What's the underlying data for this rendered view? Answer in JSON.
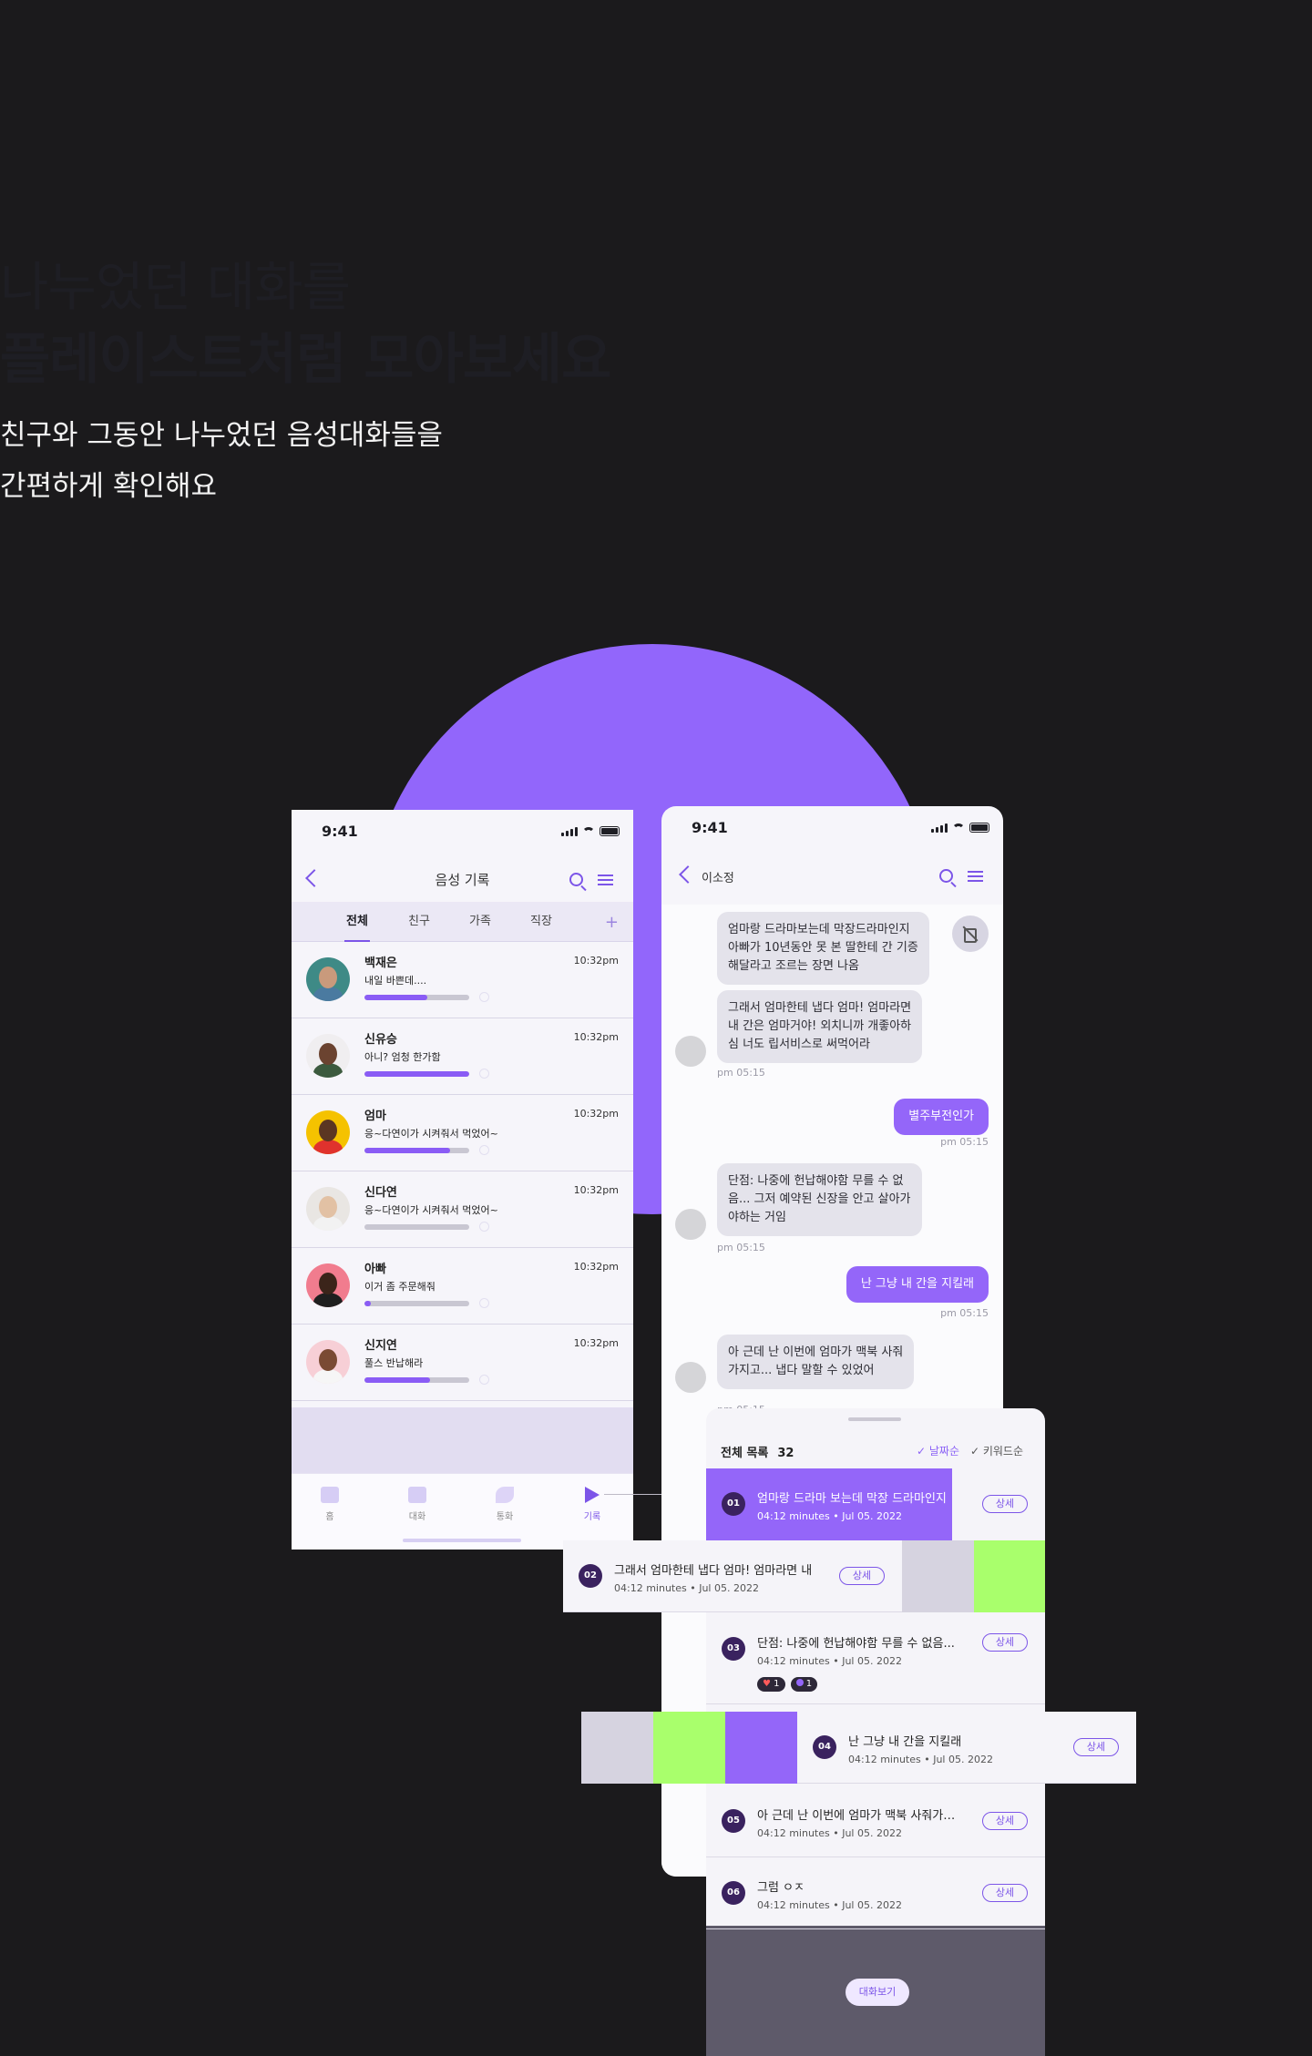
{
  "hero": {
    "line1": "나누었던 대화를",
    "line2": "플레이스트처럼 모아보세요",
    "sub1": "친구와 그동안 나누었던 음성대화들을",
    "sub2": "간편하게 확인해요"
  },
  "colors": {
    "accent": "#9466f9",
    "background": "#1b1a1c",
    "lime": "#a9ff6c",
    "lavender_gray": "#d6d3e0"
  },
  "phone_a": {
    "time": "9:41",
    "title": "음성 기록",
    "tabs": [
      "전체",
      "친구",
      "가족",
      "직장"
    ],
    "tab_add": "+",
    "contacts": [
      {
        "name": "백재은",
        "message": "내일 바쁜데....",
        "time": "10:32pm",
        "progress": 0.6,
        "avatar_bg": "#3e8a86",
        "face": "#c99a7c",
        "body": "#4a7aa0"
      },
      {
        "name": "신유승",
        "message": "아니? 엄청 한가함",
        "time": "10:32pm",
        "progress": 1.0,
        "avatar_bg": "#f0eef0",
        "face": "#6b4330",
        "body": "#3c5a3e"
      },
      {
        "name": "엄마",
        "message": "응~다연이가 시켜줘서 먹었어~",
        "time": "10:32pm",
        "progress": 0.82,
        "avatar_bg": "#f5c200",
        "face": "#5b3622",
        "body": "#e0322d"
      },
      {
        "name": "신다연",
        "message": "응~다연이가 시켜줘서 먹었어~",
        "time": "10:32pm",
        "progress": 0.0,
        "avatar_bg": "#e9e6e3",
        "face": "#e2c1a4",
        "body": "#f2f2f2"
      },
      {
        "name": "아빠",
        "message": "이거 좀 주문해줘",
        "time": "10:32pm",
        "progress": 0.06,
        "avatar_bg": "#f17c8e",
        "face": "#3b241a",
        "body": "#1f1f1f"
      },
      {
        "name": "신지연",
        "message": "풀스 반납해라",
        "time": "10:32pm",
        "progress": 0.63,
        "avatar_bg": "#f7cfd6",
        "face": "#7a4a33",
        "body": "#f6f6f6"
      }
    ],
    "tabbar": [
      "홈",
      "대화",
      "통화",
      "기록"
    ]
  },
  "phone_b": {
    "time": "9:41",
    "title": "이소정",
    "messages": [
      {
        "type": "in",
        "text": [
          "엄마랑 드라마보는데 막장드라마인지",
          "아빠가 10년동안 못 본 딸한테 간 기증",
          "해달라고 조르는 장면 나옴"
        ]
      },
      {
        "type": "in",
        "text": [
          "그래서 엄마한테 냅다 엄마! 엄마라면",
          "내 간은 엄마거야! 외치니까 개좋아하",
          "심 너도 립서비스로 써먹어라"
        ]
      },
      {
        "type": "time",
        "text": "pm 05:15"
      },
      {
        "type": "out",
        "text": "별주부전인가"
      },
      {
        "type": "time",
        "text": "pm 05:15"
      },
      {
        "type": "in",
        "text": [
          "단점: 나중에 헌납해야함 무를 수 없",
          "음... 그저 예약된 신장을 안고 살아가",
          "야하는 거임"
        ]
      },
      {
        "type": "time",
        "text": "pm 05:15"
      },
      {
        "type": "out",
        "text": "난 그냥 내 간을 지킬래"
      },
      {
        "type": "time",
        "text": "pm 05:15"
      },
      {
        "type": "in",
        "text": [
          "아 근데 난 이번에 엄마가 맥북 사줘",
          "가지고... 냅다 말할 수 있었어"
        ]
      },
      {
        "type": "time",
        "text": "pm 05:15"
      }
    ]
  },
  "sheet": {
    "header": "전체 목록",
    "count": "32",
    "sort_date": "✓ 날짜순",
    "sort_keyword": "✓ 키워드순",
    "detail_label": "상세",
    "view_button": "대화보기",
    "items": [
      {
        "num": "01",
        "title": "엄마랑 드라마 보는데 막장 드라마인지",
        "meta": "04:12 minutes  •  Jul 05. 2022"
      },
      {
        "num": "02",
        "title": "그래서 엄마한테 냅다 엄마! 엄마라면 내",
        "meta": "04:12 minutes  •  Jul 05. 2022"
      },
      {
        "num": "03",
        "title": "단점: 나중에 헌납해야함 무를 수 없음...",
        "meta": "04:12 minutes  •  Jul 05. 2022",
        "tags": [
          "1",
          "1"
        ]
      },
      {
        "num": "04",
        "title": "난 그냥 내 간을 지킬래",
        "meta": "04:12 minutes  •  Jul 05. 2022"
      },
      {
        "num": "05",
        "title": "아 근데 난 이번에 엄마가 맥북 사줘가…",
        "meta": "04:12 minutes   •  Jul 05. 2022"
      },
      {
        "num": "06",
        "title": "그럼 ㅇㅈ",
        "meta": "04:12 minutes  •  Jul 05. 2022"
      }
    ]
  }
}
